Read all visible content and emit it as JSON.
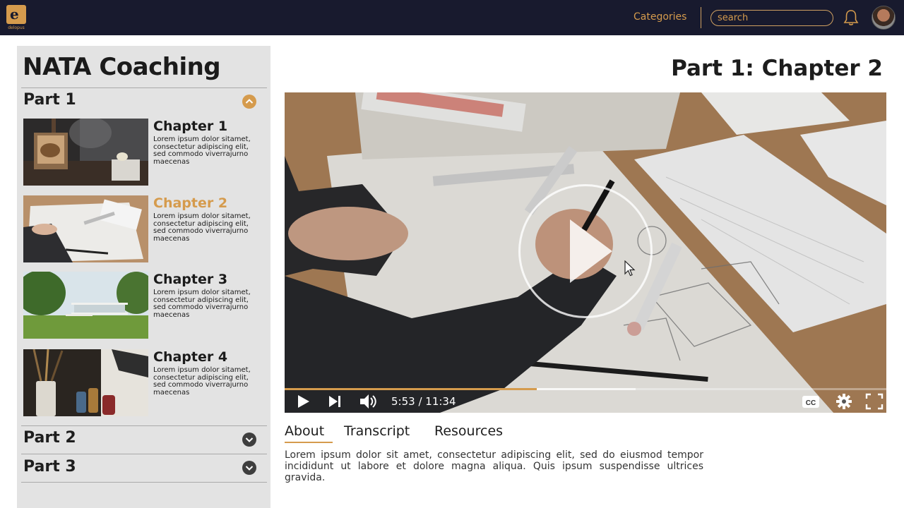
{
  "brand": {
    "name": "delopus",
    "accent": "#d59b4d",
    "nav_bg": "#181a2e"
  },
  "header": {
    "categories_label": "Categories",
    "search_placeholder": "search",
    "bell_icon": "bell-icon",
    "avatar_icon": "user-avatar"
  },
  "sidebar": {
    "course_title": "NATA Coaching",
    "parts": [
      {
        "label": "Part 1",
        "expanded": true,
        "chapters": [
          {
            "title": "Chapter 1",
            "desc": "Lorem ipsum dolor sitamet, consectetur adipiscing elit, sed commodo viverrajurno maecenas",
            "active": false
          },
          {
            "title": "Chapter 2",
            "desc": "Lorem ipsum dolor sitamet, consectetur adipiscing elit, sed commodo viverrajurno maecenas",
            "active": true
          },
          {
            "title": "Chapter 3",
            "desc": "Lorem ipsum dolor sitamet, consectetur adipiscing elit, sed commodo viverrajurno maecenas",
            "active": false
          },
          {
            "title": "Chapter 4",
            "desc": "Lorem ipsum dolor sitamet, consectetur adipiscing elit, sed commodo viverrajurno maecenas",
            "active": false
          }
        ]
      },
      {
        "label": "Part 2",
        "expanded": false
      },
      {
        "label": "Part 3",
        "expanded": false
      }
    ]
  },
  "player": {
    "title": "Part 1: Chapter 2",
    "time": "5:53 / 11:34",
    "progress": 0.51,
    "icons": [
      "play-icon",
      "next-icon",
      "volume-icon",
      "captions-icon",
      "settings-icon",
      "fullscreen-icon"
    ]
  },
  "tabs": {
    "items": [
      "About",
      "Transcript",
      "Resources"
    ],
    "active": "About"
  },
  "about": {
    "text": "Lorem ipsum dolor sit amet, consectetur adipiscing elit, sed do eiusmod tempor incididunt ut labore et dolore magna aliqua. Quis ipsum suspendisse ultrices gravida."
  }
}
